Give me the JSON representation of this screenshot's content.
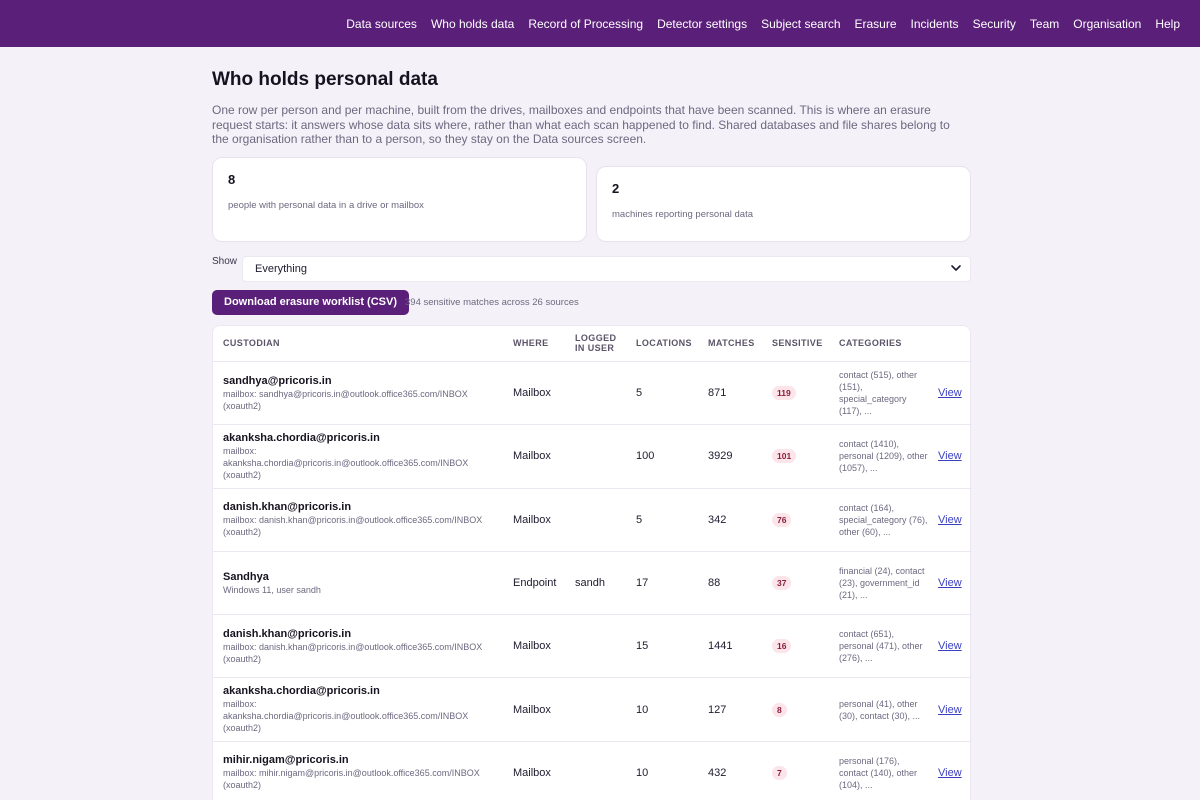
{
  "nav": {
    "items": [
      "Data sources",
      "Who holds data",
      "Record of Processing",
      "Detector settings",
      "Subject search",
      "Erasure",
      "Incidents",
      "Security",
      "Team",
      "Organisation",
      "Help"
    ]
  },
  "page": {
    "title": "Who holds personal data",
    "intro": "One row per person and per machine, built from the drives, mailboxes and endpoints that have been scanned. This is where an erasure request starts: it answers whose data sits where, rather than what each scan happened to find. Shared databases and file shares belong to the organisation rather than to a person, so they stay on the Data sources screen."
  },
  "stats": {
    "people_count": "8",
    "people_label": "people with personal data in a drive or mailbox",
    "machines_count": "2",
    "machines_label": "machines reporting personal data"
  },
  "filter": {
    "label": "Show",
    "selected": "Everything"
  },
  "actions": {
    "download_label": "Download erasure worklist (CSV)",
    "summary": "394 sensitive matches across 26 sources"
  },
  "table": {
    "headers": {
      "custodian": "CUSTODIAN",
      "where": "WHERE",
      "logged_in_user": "LOGGED IN USER",
      "locations": "LOCATIONS",
      "matches": "MATCHES",
      "sensitive": "SENSITIVE",
      "categories": "CATEGORIES"
    },
    "view_label": "View",
    "rows": [
      {
        "name": "sandhya@pricoris.in",
        "detail": "mailbox: sandhya@pricoris.in@outlook.office365.com/INBOX (xoauth2)",
        "where": "Mailbox",
        "user": "",
        "locations": "5",
        "matches": "871",
        "sensitive": "119",
        "categories": "contact (515), other (151), special_category (117), ..."
      },
      {
        "name": "akanksha.chordia@pricoris.in",
        "detail": "mailbox: akanksha.chordia@pricoris.in@outlook.office365.com/INBOX (xoauth2)",
        "where": "Mailbox",
        "user": "",
        "locations": "100",
        "matches": "3929",
        "sensitive": "101",
        "categories": "contact (1410), personal (1209), other (1057), ..."
      },
      {
        "name": "danish.khan@pricoris.in",
        "detail": "mailbox: danish.khan@pricoris.in@outlook.office365.com/INBOX (xoauth2)",
        "where": "Mailbox",
        "user": "",
        "locations": "5",
        "matches": "342",
        "sensitive": "76",
        "categories": "contact (164), special_category (76), other (60), ..."
      },
      {
        "name": "Sandhya",
        "detail": "Windows 11, user sandh",
        "where": "Endpoint",
        "user": "sandh",
        "locations": "17",
        "matches": "88",
        "sensitive": "37",
        "categories": "financial (24), contact (23), government_id (21), ..."
      },
      {
        "name": "danish.khan@pricoris.in",
        "detail": "mailbox: danish.khan@pricoris.in@outlook.office365.com/INBOX (xoauth2)",
        "where": "Mailbox",
        "user": "",
        "locations": "15",
        "matches": "1441",
        "sensitive": "16",
        "categories": "contact (651), personal (471), other (276), ..."
      },
      {
        "name": "akanksha.chordia@pricoris.in",
        "detail": "mailbox: akanksha.chordia@pricoris.in@outlook.office365.com/INBOX (xoauth2)",
        "where": "Mailbox",
        "user": "",
        "locations": "10",
        "matches": "127",
        "sensitive": "8",
        "categories": "personal (41), other (30), contact (30), ..."
      },
      {
        "name": "mihir.nigam@pricoris.in",
        "detail": "mailbox: mihir.nigam@pricoris.in@outlook.office365.com/INBOX (xoauth2)",
        "where": "Mailbox",
        "user": "",
        "locations": "10",
        "matches": "432",
        "sensitive": "7",
        "categories": "personal (176), contact (140), other (104), ..."
      }
    ]
  },
  "colors": {
    "brand": "#5a1f79",
    "background": "#f4f2f8",
    "badge_bg": "#fbe4ea",
    "badge_text": "#8c1d3a",
    "link": "#3b3fbf"
  }
}
